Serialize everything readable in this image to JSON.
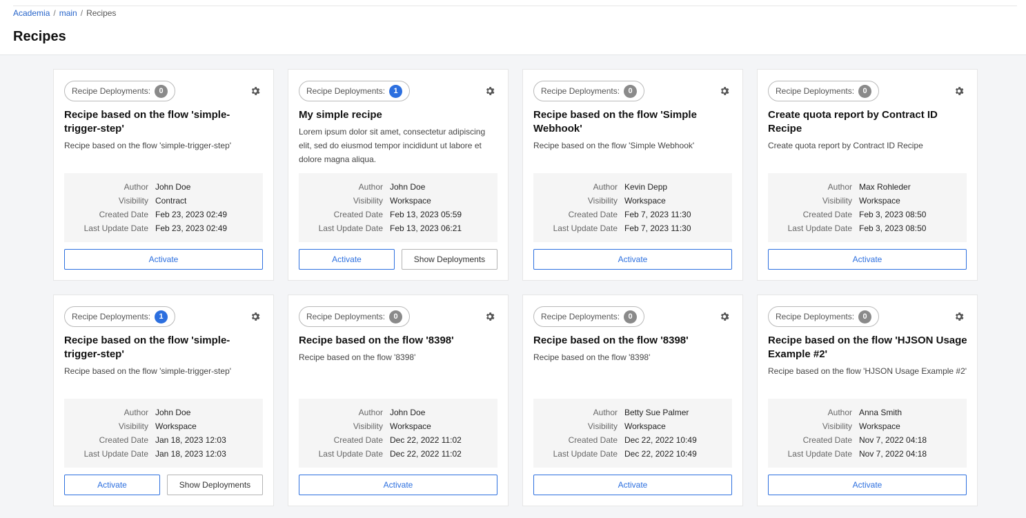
{
  "breadcrumb": [
    "Academia",
    "main",
    "Recipes"
  ],
  "page_title": "Recipes",
  "common": {
    "deployments_label": "Recipe Deployments:",
    "author_label": "Author",
    "visibility_label": "Visibility",
    "created_label": "Created Date",
    "updated_label": "Last Update Date",
    "activate_label": "Activate",
    "show_deployments_label": "Show Deployments"
  },
  "cards": [
    {
      "deployments": "0",
      "title": "Recipe based on the flow 'simple-trigger-step'",
      "description": "Recipe based on the flow 'simple-trigger-step'",
      "author": "John Doe",
      "visibility": "Contract",
      "created": "Feb 23, 2023 02:49",
      "updated": "Feb 23, 2023 02:49"
    },
    {
      "deployments": "1",
      "title": "My simple recipe",
      "description": "Lorem ipsum dolor sit amet, consectetur adipiscing elit, sed do eiusmod tempor incididunt ut labore et dolore magna aliqua.",
      "author": "John Doe",
      "visibility": "Workspace",
      "created": "Feb 13, 2023 05:59",
      "updated": "Feb 13, 2023 06:21"
    },
    {
      "deployments": "0",
      "title": "Recipe based on the flow 'Simple Webhook'",
      "description": "Recipe based on the flow 'Simple Webhook'",
      "author": "Kevin Depp",
      "visibility": "Workspace",
      "created": "Feb 7, 2023 11:30",
      "updated": "Feb 7, 2023 11:30"
    },
    {
      "deployments": "0",
      "title": "Create quota report by Contract ID Recipe",
      "description": "Create quota report by Contract ID Recipe",
      "author": "Max Rohleder",
      "visibility": "Workspace",
      "created": "Feb 3, 2023 08:50",
      "updated": "Feb 3, 2023 08:50"
    },
    {
      "deployments": "1",
      "title": "Recipe based on the flow 'simple-trigger-step'",
      "description": "Recipe based on the flow 'simple-trigger-step'",
      "author": "John Doe",
      "visibility": "Workspace",
      "created": "Jan 18, 2023 12:03",
      "updated": "Jan 18, 2023 12:03"
    },
    {
      "deployments": "0",
      "title": "Recipe based on the flow '8398'",
      "description": "Recipe based on the flow '8398'",
      "author": "John Doe",
      "visibility": "Workspace",
      "created": "Dec 22, 2022 11:02",
      "updated": "Dec 22, 2022 11:02"
    },
    {
      "deployments": "0",
      "title": "Recipe based on the flow '8398'",
      "description": "Recipe based on the flow '8398'",
      "author": "Betty Sue Palmer",
      "visibility": "Workspace",
      "created": "Dec 22, 2022 10:49",
      "updated": "Dec 22, 2022 10:49"
    },
    {
      "deployments": "0",
      "title": "Recipe based on the flow 'HJSON Usage Example #2'",
      "description": "Recipe based on the flow 'HJSON Usage Example #2'",
      "author": "Anna Smith",
      "visibility": "Workspace",
      "created": "Nov 7, 2022 04:18",
      "updated": "Nov 7, 2022 04:18"
    }
  ],
  "colors": {
    "accent": "#2c6fdf",
    "badge_gray": "#8a8a8a",
    "background": "#f4f5f7"
  },
  "icons": {
    "settings": "gear-icon"
  }
}
